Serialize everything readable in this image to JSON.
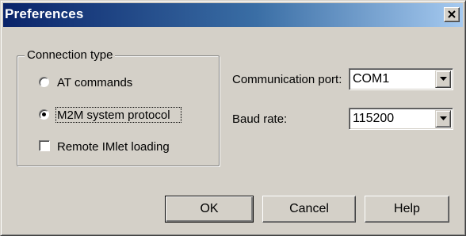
{
  "window": {
    "title": "Preferences"
  },
  "connection_group": {
    "legend": "Connection type",
    "options": [
      {
        "label": "AT commands",
        "selected": false
      },
      {
        "label": "M2M system protocol",
        "selected": true
      }
    ],
    "remote_loading": {
      "label": "Remote IMlet loading",
      "checked": false
    }
  },
  "settings": {
    "port_label": "Communication port:",
    "port_value": "COM1",
    "baud_label": "Baud rate:",
    "baud_value": "115200"
  },
  "buttons": {
    "ok": "OK",
    "cancel": "Cancel",
    "help": "Help"
  },
  "icons": {
    "close": "close-icon",
    "dropdown": "chevron-down-icon"
  },
  "colors": {
    "titlebar_start": "#0a246a",
    "titlebar_end": "#a6caf0",
    "face": "#d4d0c8"
  }
}
